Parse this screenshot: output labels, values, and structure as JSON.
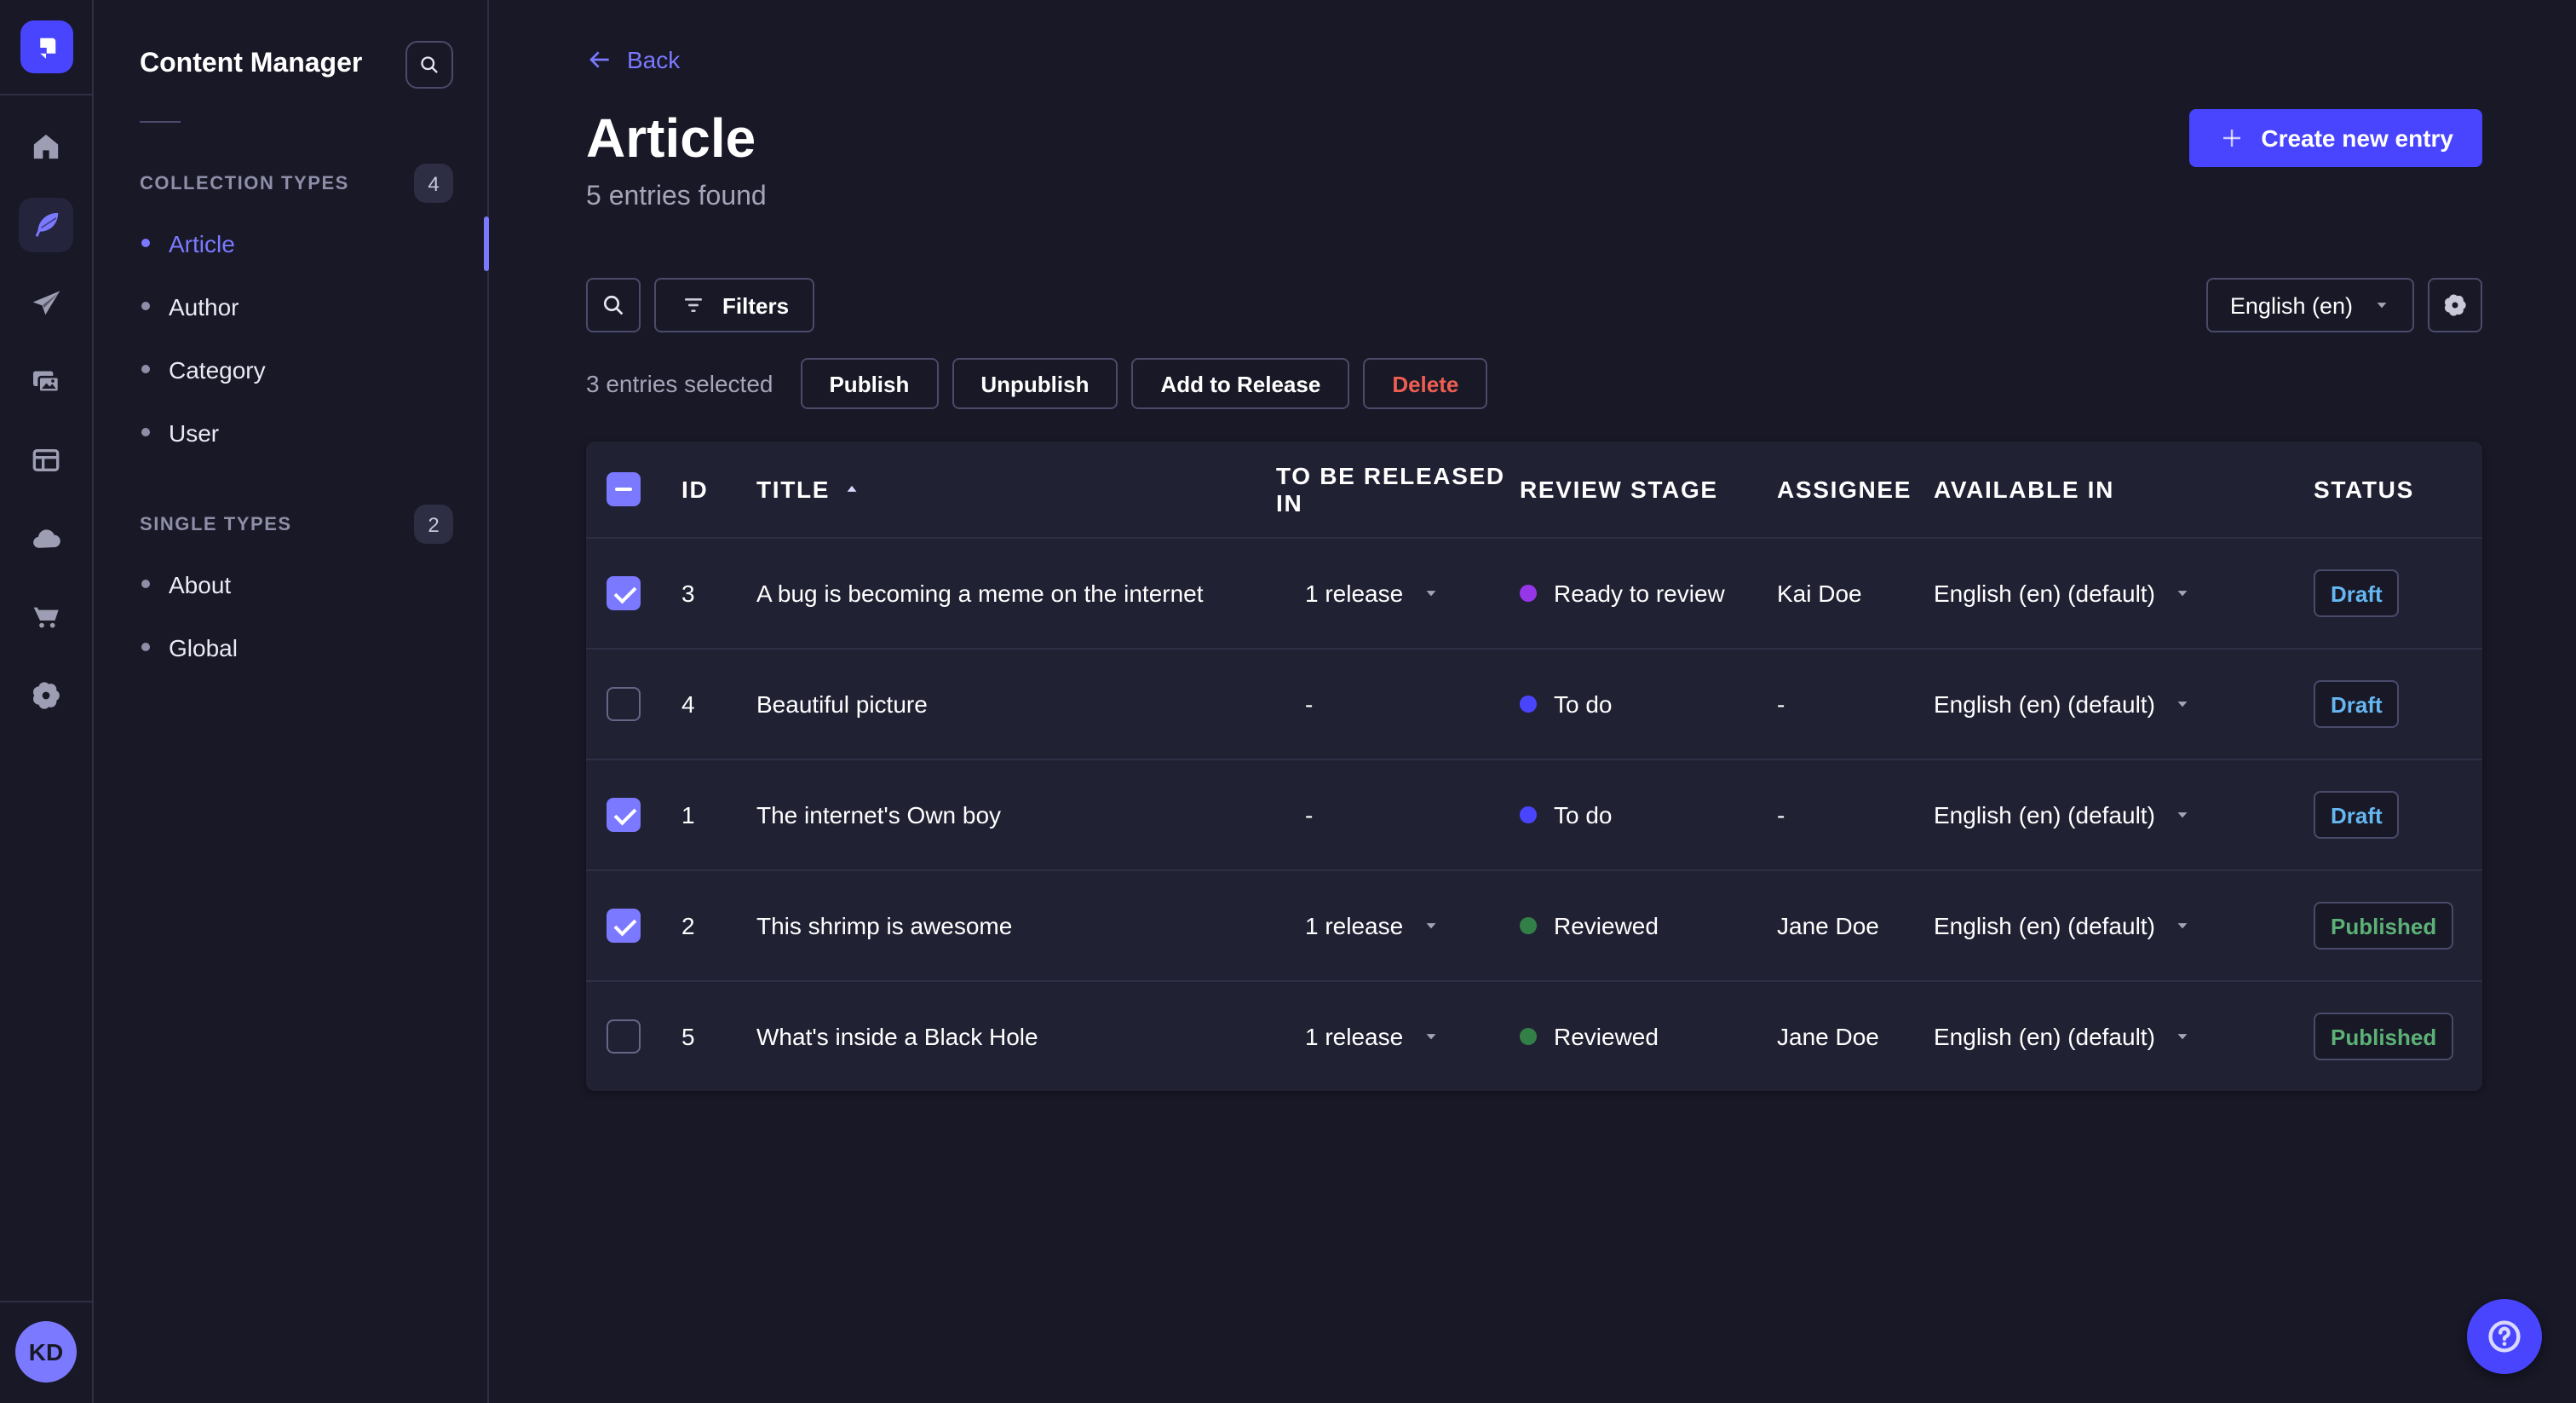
{
  "app": {
    "accent_color": "#4945ff",
    "accent_light_color": "#7b79ff",
    "page_bg_color": "#181826",
    "card_bg_color": "#212134",
    "danger_color": "#ee5e52"
  },
  "rail": {
    "logo_icon": "strapi-logo-icon",
    "items": [
      {
        "icon": "home-icon",
        "active": false
      },
      {
        "icon": "feather-icon",
        "active": true
      },
      {
        "icon": "paper-plane-icon",
        "active": false
      },
      {
        "icon": "images-icon",
        "active": false
      },
      {
        "icon": "layout-icon",
        "active": false
      },
      {
        "icon": "cloud-icon",
        "active": false
      },
      {
        "icon": "cart-icon",
        "active": false
      },
      {
        "icon": "gear-icon",
        "active": false
      }
    ],
    "avatar_initials": "KD"
  },
  "sidebar": {
    "title": "Content Manager",
    "search_icon": "search-icon",
    "sections": [
      {
        "label": "COLLECTION TYPES",
        "badge": "4",
        "items": [
          {
            "label": "Article",
            "active": true
          },
          {
            "label": "Author",
            "active": false
          },
          {
            "label": "Category",
            "active": false
          },
          {
            "label": "User",
            "active": false
          }
        ]
      },
      {
        "label": "SINGLE TYPES",
        "badge": "2",
        "items": [
          {
            "label": "About",
            "active": false
          },
          {
            "label": "Global",
            "active": false
          }
        ]
      }
    ]
  },
  "header": {
    "back_label": "Back",
    "title": "Article",
    "subtitle": "5 entries found",
    "create_button_label": "Create new entry"
  },
  "toolbar": {
    "search_icon": "search-icon",
    "filters_label": "Filters",
    "filters_icon": "filter-funnel-icon",
    "locale_selected": "English (en)",
    "settings_icon": "gear-icon"
  },
  "selection": {
    "summary": "3 entries selected",
    "actions": [
      {
        "label": "Publish",
        "variant": "default"
      },
      {
        "label": "Unpublish",
        "variant": "default"
      },
      {
        "label": "Add to Release",
        "variant": "default"
      },
      {
        "label": "Delete",
        "variant": "danger"
      }
    ]
  },
  "table": {
    "columns": [
      "ID",
      "TITLE",
      "TO BE RELEASED IN",
      "REVIEW STAGE",
      "ASSIGNEE",
      "AVAILABLE IN",
      "STATUS"
    ],
    "sorted_column": "TITLE",
    "sort_direction": "asc",
    "header_checkbox_state": "indeterminate",
    "rows": [
      {
        "selected": true,
        "id": "3",
        "title": "A bug is becoming a meme on the internet",
        "to_be_released_in": "1 release",
        "has_release_dropdown": true,
        "review_stage": "Ready to review",
        "review_stage_color": "#9736e8",
        "assignee": "Kai Doe",
        "available_in": "English (en) (default)",
        "status": "Draft",
        "status_color": "#66b7f1"
      },
      {
        "selected": false,
        "id": "4",
        "title": "Beautiful picture",
        "to_be_released_in": "-",
        "has_release_dropdown": false,
        "review_stage": "To do",
        "review_stage_color": "#4945ff",
        "assignee": "-",
        "available_in": "English (en) (default)",
        "status": "Draft",
        "status_color": "#66b7f1"
      },
      {
        "selected": true,
        "id": "1",
        "title": "The internet's Own boy",
        "to_be_released_in": "-",
        "has_release_dropdown": false,
        "review_stage": "To do",
        "review_stage_color": "#4945ff",
        "assignee": "-",
        "available_in": "English (en) (default)",
        "status": "Draft",
        "status_color": "#66b7f1"
      },
      {
        "selected": true,
        "id": "2",
        "title": "This shrimp is awesome",
        "to_be_released_in": "1 release",
        "has_release_dropdown": true,
        "review_stage": "Reviewed",
        "review_stage_color": "#328048",
        "assignee": "Jane Doe",
        "available_in": "English (en) (default)",
        "status": "Published",
        "status_color": "#5cb176"
      },
      {
        "selected": false,
        "id": "5",
        "title": "What's inside a Black Hole",
        "to_be_released_in": "1 release",
        "has_release_dropdown": true,
        "review_stage": "Reviewed",
        "review_stage_color": "#328048",
        "assignee": "Jane Doe",
        "available_in": "English (en) (default)",
        "status": "Published",
        "status_color": "#5cb176"
      }
    ]
  },
  "help": {
    "icon": "question-mark-icon"
  }
}
